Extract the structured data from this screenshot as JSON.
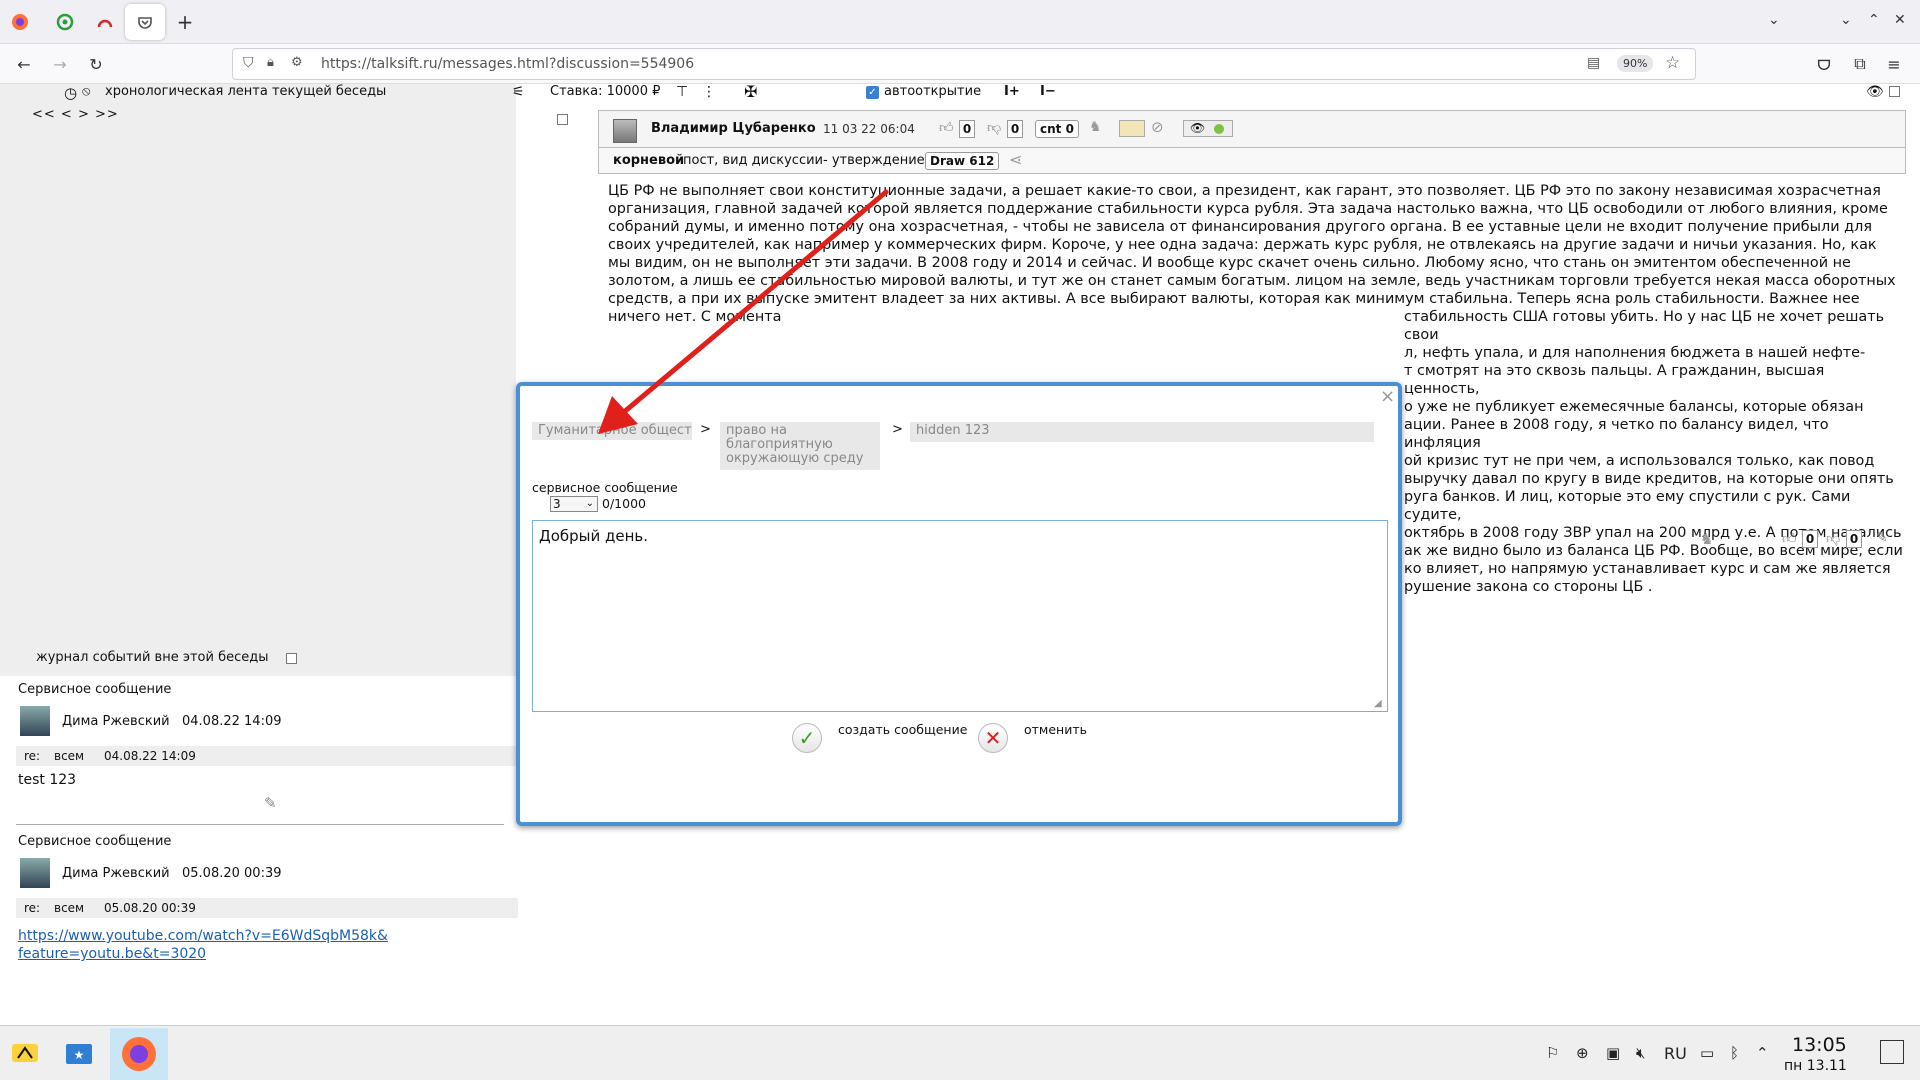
{
  "browser": {
    "url": "https://talksift.ru/messages.html?discussion=554906",
    "zoom": "90%"
  },
  "toolbar": {
    "timeline_label": "хронологическая лента текущей беседы",
    "stake_label": "Ставка: 10000 ₽",
    "autoopen_label": "автооткрытие",
    "pager": "<<  <  >  >>"
  },
  "post": {
    "author": "Владимир Цубаренко",
    "datetime": "11 03 22 06:04",
    "likes": "0",
    "dislikes": "0",
    "cnt": "cnt 0",
    "root_label": "корневой",
    "post_type": "пост, вид дискуссии- утверждение",
    "draw": "Draw 612",
    "body": "ЦБ РФ не выполняет свои конституционные задачи, а решает какие-то свои, а президент, как гарант, это позволяет. ЦБ РФ это по закону независимая хозрасчетная организация, главной задачей которой является поддержание стабильности курса рубля. Эта задача настолько важна, что ЦБ освободили от любого влияния, кроме собраний думы, и именно потому она хозрасчетная, - чтобы не зависела от финансирования другого органа. В ее уставные цели не входит получение прибыли для своих учредителей, как например у коммерческих фирм. Короче, у нее одна задача: держать курс рубля, не отвлекаясь на другие задачи и ничьи указания. Но, как мы видим, он не выполняет эти задачи. В 2008 году и 2014 и сейчас. И вообще курс скачет очень сильно. Любому ясно, что стань он эмитентом обеспеченной не золотом, а лишь ее стабильностью мировой валюты, и тут же он станет самым богатым. лицом на земле, ведь участникам торговли требуется некая масса оборотных средств, а при их выпуске эмитент владеет за них активы. А все выбирают валюты, которая как минимум стабильна. Теперь ясна роль стабильности. Важнее нее ничего нет. С момента",
    "body_right": [
      "стабильность США готовы убить. Но у нас ЦБ не хочет решать свои",
      "л, нефть упала, и для наполнения бюджета в нашей нефте-",
      "т смотрят на это сквозь пальцы. А гражданин, высшая ценность,",
      "о уже не публикует ежемесячные балансы, которые обязан",
      "ации. Ранее в 2008 году, я четко по балансу видел, что инфляция",
      "ой кризис тут не при чем, а использовался только, как повод",
      "выручку давал по кругу в виде кредитов, на которые они опять",
      "руга банков. И лиц, которые это ему спустили с рук. Сами судите,",
      "октябрь в 2008 году ЗВР упал на 200 млрд у.е. А потом начались",
      "ак же видно было из баланса ЦБ РФ. Вообще, во всем мире, если",
      "ко влияет, но напрямую устанавливает курс и сам же является",
      "рушение закона со стороны ЦБ ."
    ],
    "footer_likes": "0",
    "footer_dislikes": "0"
  },
  "dialog": {
    "crumbs": [
      "Гуманитарное общество",
      "право на благоприятную окружающую среду",
      "hidden 123"
    ],
    "crumb_sep": ">",
    "service_label": "сервисное сообщение",
    "select_value": "3",
    "counter": "0/1000",
    "text_value": "Добрый день.",
    "create_label": "создать сообщение",
    "cancel_label": "отменить",
    "close": "×"
  },
  "journal": {
    "label": "журнал событий вне этой беседы",
    "items": [
      {
        "title": "Сервисное сообщение",
        "author": "Дима Ржевский",
        "datetime": "04.08.22 14:09",
        "re": "re:",
        "to": "всем",
        "re_date": "04.08.22 14:09",
        "text": "test 123"
      },
      {
        "title": "Сервисное сообщение",
        "author": "Дима Ржевский",
        "datetime": "05.08.20 00:39",
        "re": "re:",
        "to": "всем",
        "re_date": "05.08.20 00:39",
        "link_line1": "https://www.youtube.com/watch?v=E6WdSqbM58k&",
        "link_line2": "feature=youtu.be&t=3020"
      }
    ]
  },
  "taskbar": {
    "lang": "RU",
    "time": "13:05",
    "date": "пн 13.11"
  },
  "colors": {
    "dialog_border": "#4a90d9",
    "annotation_arrow": "#e0201a",
    "accept_green": "#3a9d23",
    "cancel_red": "#d42020"
  }
}
